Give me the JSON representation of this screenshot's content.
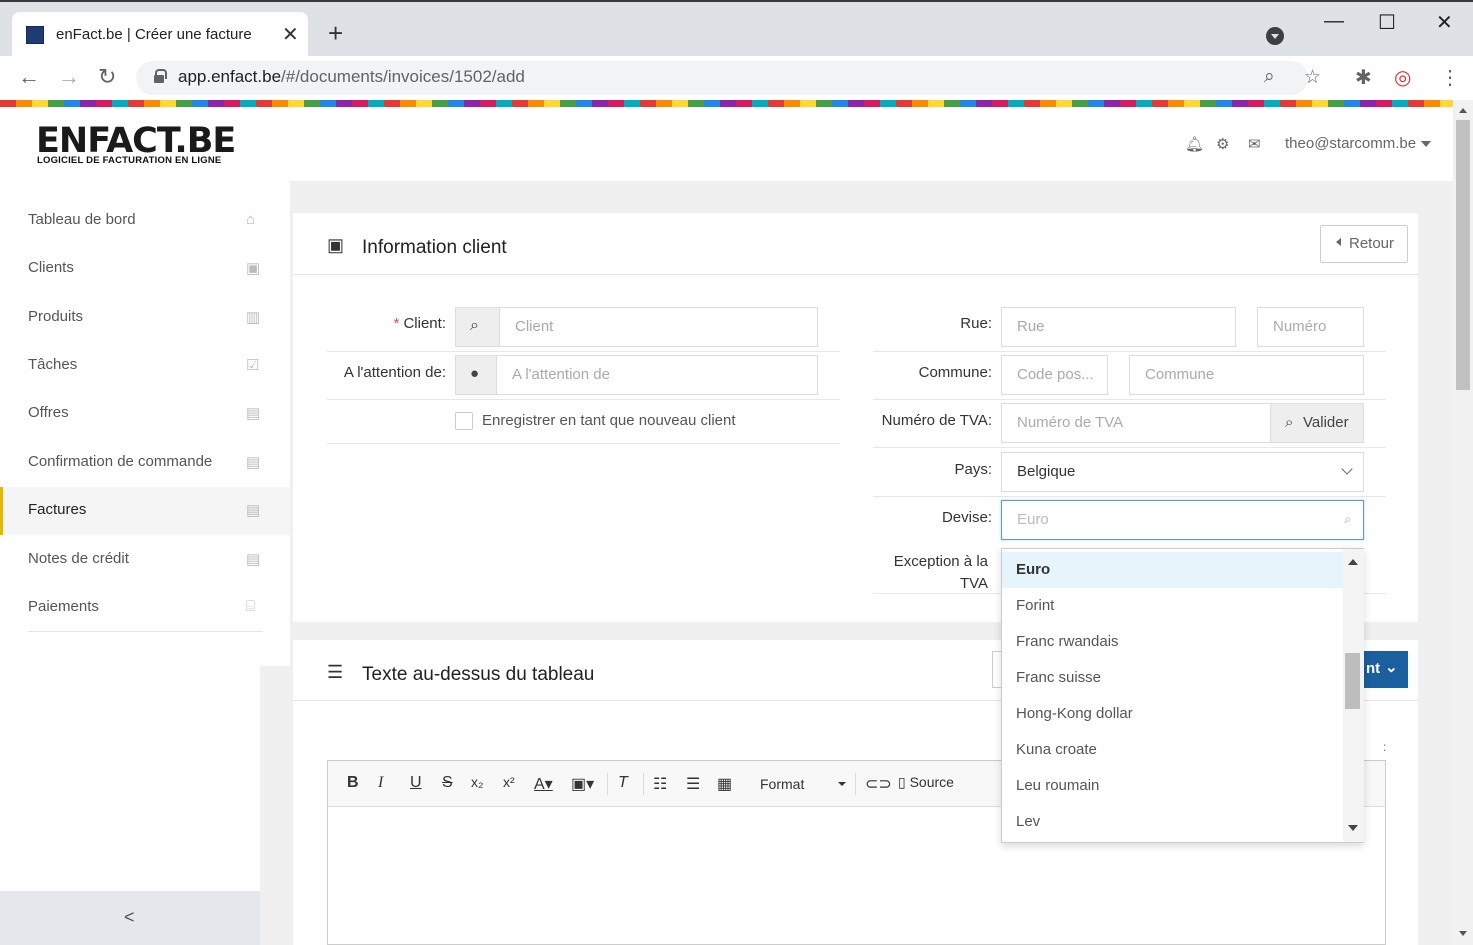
{
  "browser": {
    "tab_title": "enFact.be | Créer une facture",
    "tab_close": "✕",
    "new_tab": "+",
    "url_host": "app.enfact.be",
    "url_path": "/#/documents/invoices/1502/add",
    "minimize": "—",
    "maximize": "☐",
    "close": "✕"
  },
  "header": {
    "logo_title": "ENFACT.BE",
    "logo_subtitle": "LOGICIEL DE FACTURATION EN LIGNE",
    "user_email": "theo@starcomm.be"
  },
  "sidebar": {
    "items": [
      {
        "label": "Tableau de bord",
        "icon": "home-icon",
        "glyph": "⌂",
        "active": false
      },
      {
        "label": "Clients",
        "icon": "contact-book-icon",
        "glyph": "▣",
        "active": false
      },
      {
        "label": "Produits",
        "icon": "barcode-icon",
        "glyph": "▥",
        "active": false
      },
      {
        "label": "Tâches",
        "icon": "checklist-icon",
        "glyph": "☑",
        "active": false
      },
      {
        "label": "Offres",
        "icon": "pdf-file-icon",
        "glyph": "▤",
        "active": false
      },
      {
        "label": "Confirmation de commande",
        "icon": "pdf-file-icon",
        "glyph": "▤",
        "active": false
      },
      {
        "label": "Factures",
        "icon": "pdf-file-icon",
        "glyph": "▤",
        "active": true
      },
      {
        "label": "Notes de crédit",
        "icon": "pdf-file-icon",
        "glyph": "▤",
        "active": false
      },
      {
        "label": "Paiements",
        "icon": "bank-icon",
        "glyph": "⌸",
        "active": false
      }
    ],
    "collapse_glyph": "<"
  },
  "client_card": {
    "title": "Information client",
    "back_label": "Retour",
    "client_label": "Client",
    "client_placeholder": "Client",
    "attention_label": "A l'attention de",
    "attention_placeholder": "A l'attention de",
    "save_new_client_label": "Enregistrer en tant que nouveau client",
    "street_label": "Rue",
    "street_placeholder": "Rue",
    "number_placeholder": "Numéro",
    "commune_label": "Commune",
    "postcode_placeholder": "Code pos...",
    "commune_placeholder": "Commune",
    "vat_label": "Numéro de TVA",
    "vat_placeholder": "Numéro de TVA",
    "validate_label": "Valider",
    "country_label": "Pays",
    "country_value": "Belgique",
    "currency_label": "Devise",
    "currency_placeholder": "Euro",
    "vat_exception_label_1": "Exception à la",
    "vat_exception_label_2": "TVA"
  },
  "currency_dropdown": {
    "options": [
      "Euro",
      "Forint",
      "Franc rwandais",
      "Franc suisse",
      "Hong-Kong dollar",
      "Kuna croate",
      "Leu roumain",
      "Lev"
    ],
    "selected": "Euro"
  },
  "text_card": {
    "title": "Texte au-dessus du tableau",
    "blue_button_label": "nt"
  },
  "editor": {
    "format_label": "Format",
    "source_label": "Source"
  },
  "colors": {
    "accent_yellow": "#e6b800",
    "primary_blue": "#1a5f9e",
    "focus_blue": "#5b9bd5"
  }
}
